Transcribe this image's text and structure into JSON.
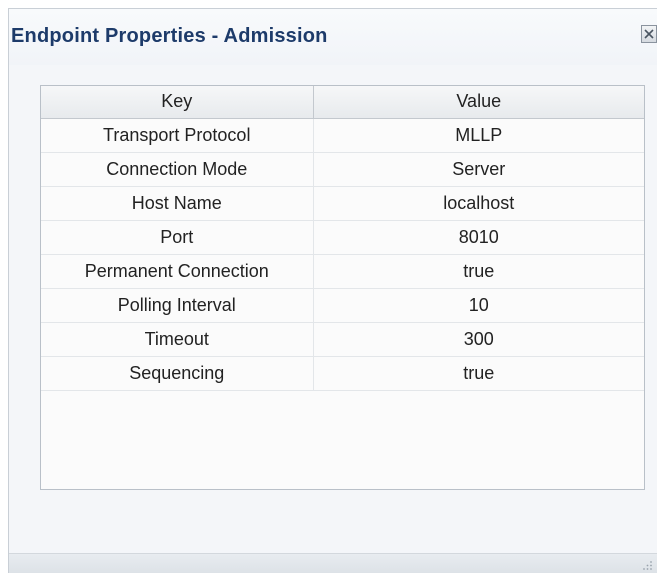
{
  "dialog": {
    "title": "Endpoint Properties - Admission",
    "close_icon": "close-icon"
  },
  "table": {
    "columns": [
      "Key",
      "Value"
    ],
    "rows": [
      {
        "key": "Transport Protocol",
        "value": "MLLP"
      },
      {
        "key": "Connection Mode",
        "value": "Server"
      },
      {
        "key": "Host Name",
        "value": "localhost"
      },
      {
        "key": "Port",
        "value": "8010"
      },
      {
        "key": "Permanent Connection",
        "value": "true"
      },
      {
        "key": "Polling Interval",
        "value": "10"
      },
      {
        "key": "Timeout",
        "value": "300"
      },
      {
        "key": "Sequencing",
        "value": "true"
      }
    ]
  },
  "colors": {
    "title": "#1d3b6a",
    "dialog_bg": "#f4f6f9",
    "table_bg": "#fbfbfb"
  }
}
